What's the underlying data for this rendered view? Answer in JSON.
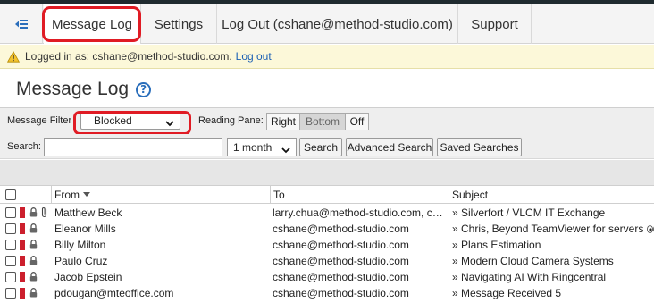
{
  "nav": {
    "tabs": [
      {
        "label": "Message Log",
        "active": true
      },
      {
        "label": "Settings",
        "active": false
      },
      {
        "label": "Log Out (cshane@method-studio.com)",
        "active": false
      },
      {
        "label": "Support",
        "active": false
      }
    ],
    "collapse_icon": "collapse-sidebar-icon"
  },
  "login_bar": {
    "text": "Logged in as: cshane@method-studio.com.",
    "logout_link": "Log out",
    "icon": "warning-icon"
  },
  "page": {
    "title": "Message Log",
    "help_symbol": "?"
  },
  "filter": {
    "label": "Message Filter",
    "selected": "Blocked",
    "reading_pane_label": "Reading Pane:",
    "reading_pane_options": [
      "Right",
      "Bottom",
      "Off"
    ],
    "reading_pane_selected": "Bottom"
  },
  "search": {
    "label": "Search:",
    "value": "",
    "period": "1 month",
    "search_button": "Search",
    "advanced_button": "Advanced Search",
    "saved_button": "Saved Searches"
  },
  "columns": {
    "from": "From",
    "to": "To",
    "subject": "Subject"
  },
  "rows": [
    {
      "from": "Matthew Beck",
      "to": "larry.chua@method-studio.com, csha...",
      "subject": "» Silverfort / VLCM IT Exchange",
      "attachment": true,
      "eyes": false
    },
    {
      "from": "Eleanor Mills",
      "to": "cshane@method-studio.com",
      "subject": "» Chris, Beyond TeamViewer for servers",
      "attachment": false,
      "eyes": true
    },
    {
      "from": "Billy Milton",
      "to": "cshane@method-studio.com",
      "subject": "» Plans Estimation",
      "attachment": false,
      "eyes": false
    },
    {
      "from": "Paulo Cruz",
      "to": "cshane@method-studio.com",
      "subject": "» Modern Cloud Camera Systems",
      "attachment": false,
      "eyes": false
    },
    {
      "from": "Jacob Epstein",
      "to": "cshane@method-studio.com",
      "subject": "» Navigating AI With Ringcentral",
      "attachment": false,
      "eyes": false
    },
    {
      "from": "pdougan@mteoffice.com",
      "to": "cshane@method-studio.com",
      "subject": "» Message Received 5",
      "attachment": false,
      "eyes": false
    }
  ],
  "colors": {
    "highlight": "#e01b24",
    "flag": "#cc1f2d",
    "link": "#1a5fb4",
    "banner": "#fcf8d9"
  }
}
